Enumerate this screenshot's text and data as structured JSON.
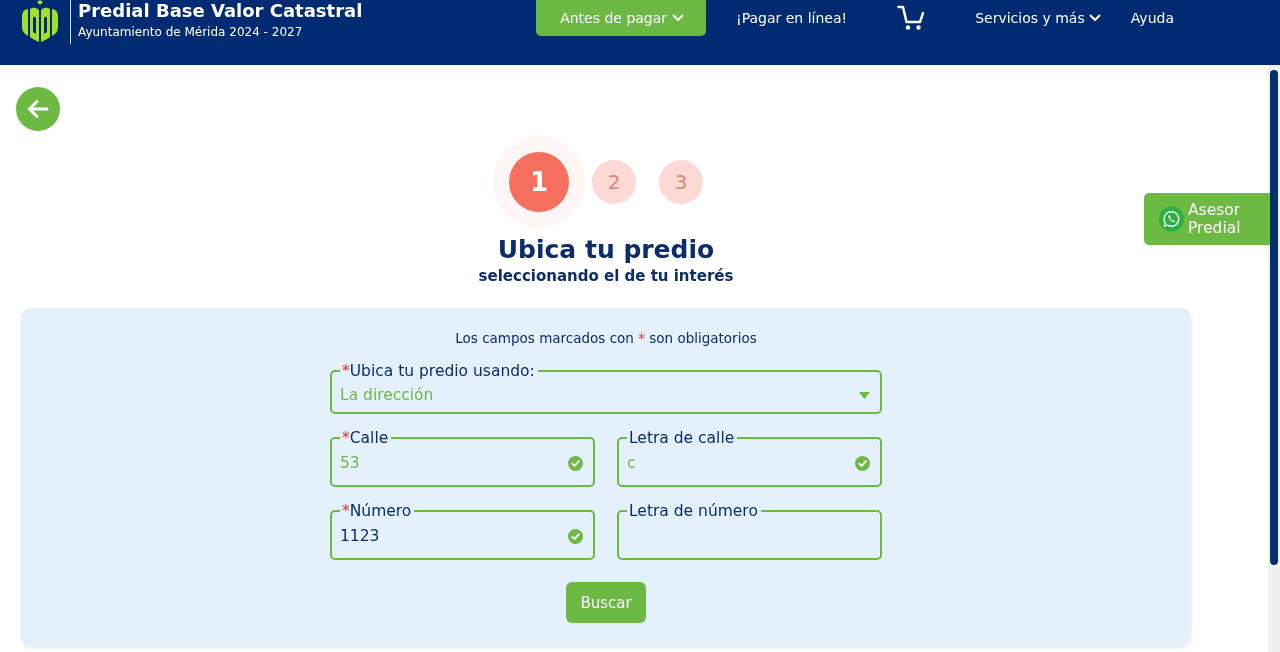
{
  "header": {
    "title": "Predial Base Valor Catastral",
    "subtitle": "Ayuntamiento de Mérida 2024 - 2027",
    "nav": [
      {
        "kind": "button",
        "label": "Antes de pagar",
        "dropdown": true
      },
      {
        "kind": "link",
        "label": "¡Pagar en línea!",
        "dropdown": false
      },
      {
        "kind": "cart"
      },
      {
        "kind": "link",
        "label": "Servicios y más",
        "dropdown": true
      },
      {
        "kind": "link",
        "label": "Ayuda",
        "dropdown": false
      }
    ]
  },
  "steps": [
    {
      "label": "1",
      "selected": true
    },
    {
      "label": "2",
      "selected": false
    },
    {
      "label": "3",
      "selected": false
    }
  ],
  "heading": {
    "title": "Ubica tu predio",
    "subtitle": "seleccionando el de tu interés"
  },
  "form": {
    "note": {
      "before": "Los campos marcados con",
      "mark": "*",
      "after": "son obligatorios"
    },
    "fields": [
      {
        "kind": "select",
        "required_mark": "*",
        "label": "Ubica tu predio usando:",
        "value": "La dirección",
        "emphasized": true
      },
      {
        "kind": "text",
        "required_mark": "*",
        "label": "Calle",
        "value": "53",
        "emphasized": true,
        "valid": true
      },
      {
        "kind": "text",
        "label": "Letra de calle",
        "value": "c",
        "emphasized": true,
        "valid": true
      },
      {
        "kind": "text",
        "required_mark": "*",
        "label": "Número",
        "value": "1123",
        "emphasized": false,
        "valid": true
      },
      {
        "kind": "text",
        "label": "Letra de número",
        "valid": false
      }
    ],
    "submit": "Buscar"
  },
  "advisor_button": {
    "label": "Asesor Predial"
  }
}
